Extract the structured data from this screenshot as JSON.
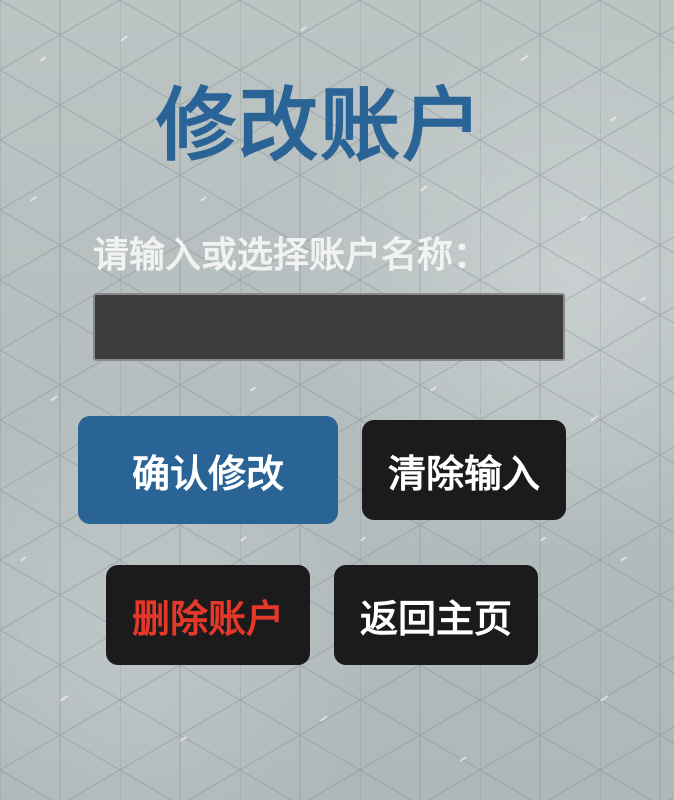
{
  "page": {
    "title": "修改账户",
    "prompt": "请输入或选择账户名称：",
    "account_input": {
      "value": "",
      "placeholder": ""
    }
  },
  "buttons": {
    "confirm_label": "确认修改",
    "clear_label": "清除输入",
    "delete_label": "删除账户",
    "home_label": "返回主页"
  },
  "colors": {
    "title": "#2a6496",
    "primary_button": "#2a6496",
    "dark_button": "#1b1b1b",
    "delete_text": "#e5382b",
    "input_background": "#3c3c3c"
  }
}
